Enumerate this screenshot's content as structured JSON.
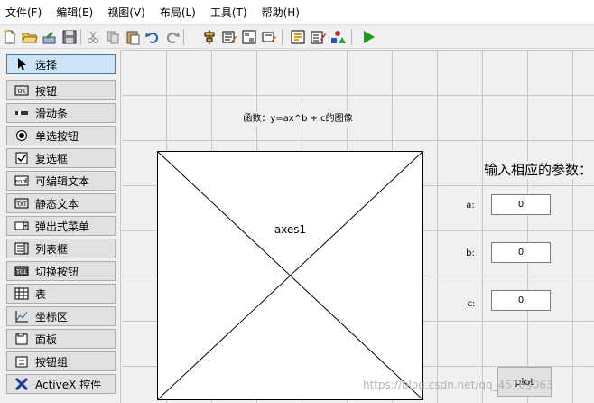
{
  "menubar": {
    "items": [
      "文件(F)",
      "编辑(E)",
      "视图(V)",
      "布局(L)",
      "工具(T)",
      "帮助(H)"
    ]
  },
  "toolbar": {
    "buttons": [
      "new-icon",
      "open-icon",
      "export-icon",
      "save-icon",
      "cut-icon",
      "copy-icon",
      "paste-icon",
      "undo-icon",
      "redo-icon",
      "align-icon",
      "menu-editor-icon",
      "tab-order-icon",
      "toolbar-editor-icon",
      "editor-icon",
      "property-inspector-icon",
      "object-browser-icon",
      "run-icon"
    ],
    "run_color": "#1a9a1a"
  },
  "palette": {
    "items": [
      {
        "label": "选择",
        "icon": "arrow-cursor-icon",
        "selected": true
      },
      {
        "label": "按钮",
        "icon": "push-button-icon",
        "selected": false
      },
      {
        "label": "滑动条",
        "icon": "slider-icon",
        "selected": false
      },
      {
        "label": "单选按钮",
        "icon": "radio-button-icon",
        "selected": false
      },
      {
        "label": "复选框",
        "icon": "checkbox-icon",
        "selected": false
      },
      {
        "label": "可编辑文本",
        "icon": "edit-text-icon",
        "selected": false
      },
      {
        "label": "静态文本",
        "icon": "static-text-icon",
        "selected": false
      },
      {
        "label": "弹出式菜单",
        "icon": "popup-menu-icon",
        "selected": false
      },
      {
        "label": "列表框",
        "icon": "listbox-icon",
        "selected": false
      },
      {
        "label": "切换按钮",
        "icon": "toggle-button-icon",
        "selected": false
      },
      {
        "label": "表",
        "icon": "table-icon",
        "selected": false
      },
      {
        "label": "坐标区",
        "icon": "axes-icon",
        "selected": false
      },
      {
        "label": "面板",
        "icon": "panel-icon",
        "selected": false
      },
      {
        "label": "按钮组",
        "icon": "button-group-icon",
        "selected": false
      },
      {
        "label": "ActiveX 控件",
        "icon": "activex-icon",
        "selected": false
      }
    ]
  },
  "canvas": {
    "title_text": "函数：y=ax^b + c的图像",
    "axes_label": "axes1",
    "param_heading": "输入相应的参数：",
    "params": [
      {
        "label": "a:",
        "value": "0"
      },
      {
        "label": "b:",
        "value": "0"
      },
      {
        "label": "c:",
        "value": "0"
      }
    ],
    "plot_button": "plot"
  },
  "watermark": "https://blog.csdn.net/qq_45769063"
}
